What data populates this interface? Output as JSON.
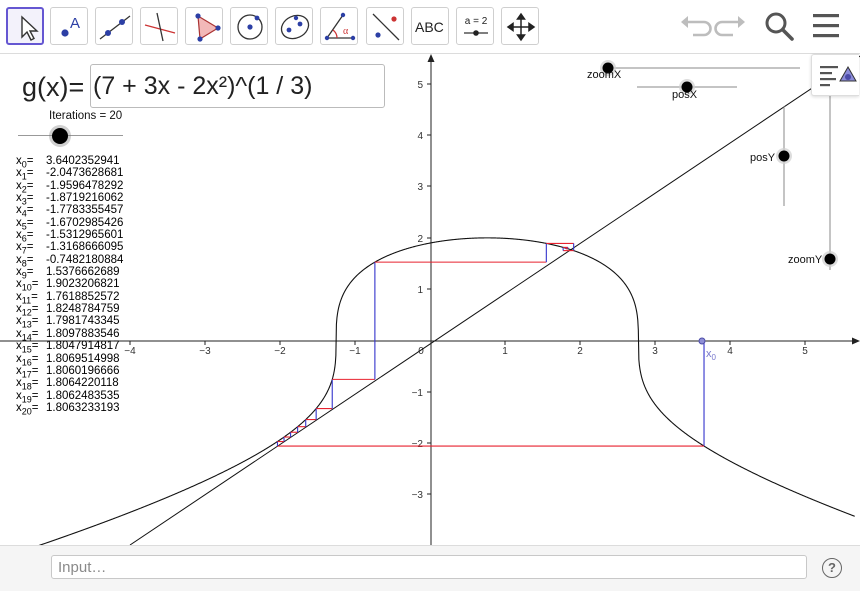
{
  "toolbar": {
    "tools": [
      {
        "name": "move-tool",
        "icon": "arrow-cursor-icon",
        "selected": true
      },
      {
        "name": "point-tool",
        "icon": "point-icon",
        "label": "A"
      },
      {
        "name": "line-tool",
        "icon": "line-through-points-icon"
      },
      {
        "name": "perpendicular-line-tool",
        "icon": "perpendicular-line-icon"
      },
      {
        "name": "polygon-tool",
        "icon": "polygon-icon"
      },
      {
        "name": "circle-center-tool",
        "icon": "circle-with-center-icon"
      },
      {
        "name": "ellipse-tool",
        "icon": "ellipse-icon"
      },
      {
        "name": "angle-tool",
        "icon": "angle-icon",
        "label": "α"
      },
      {
        "name": "reflect-tool",
        "icon": "reflect-about-line-icon"
      },
      {
        "name": "text-tool",
        "icon": "text-icon",
        "label": "ABC"
      },
      {
        "name": "slider-tool",
        "icon": "slider-icon",
        "label": "a = 2"
      },
      {
        "name": "move-graphics-view-tool",
        "icon": "move-view-icon"
      }
    ],
    "undo_icon": "undo-icon",
    "redo_icon": "redo-icon",
    "search_icon": "search-icon",
    "menu_icon": "hamburger-menu-icon"
  },
  "formula": {
    "label": "g(x)=",
    "value": "(7 + 3x - 2x²)^(1 / 3)"
  },
  "iterations": {
    "label": "Iterations = 20",
    "value": 20
  },
  "iterates": [
    {
      "sub": "0",
      "value": "3.6402352941"
    },
    {
      "sub": "1",
      "value": "-2.0473628681"
    },
    {
      "sub": "2",
      "value": "-1.9596478292"
    },
    {
      "sub": "3",
      "value": "-1.8719216062"
    },
    {
      "sub": "4",
      "value": "-1.7783355457"
    },
    {
      "sub": "5",
      "value": "-1.6702985426"
    },
    {
      "sub": "6",
      "value": "-1.5312965601"
    },
    {
      "sub": "7",
      "value": "-1.3168666095"
    },
    {
      "sub": "8",
      "value": "-0.7482180884"
    },
    {
      "sub": "9",
      "value": "1.5376662689"
    },
    {
      "sub": "10",
      "value": "1.9023206821"
    },
    {
      "sub": "11",
      "value": "1.7618852572"
    },
    {
      "sub": "12",
      "value": "1.8248784759"
    },
    {
      "sub": "13",
      "value": "1.7981743345"
    },
    {
      "sub": "14",
      "value": "1.8097883546"
    },
    {
      "sub": "15",
      "value": "1.8047914817"
    },
    {
      "sub": "16",
      "value": "1.8069514998"
    },
    {
      "sub": "17",
      "value": "1.8060196666"
    },
    {
      "sub": "18",
      "value": "1.8064220118"
    },
    {
      "sub": "19",
      "value": "1.8062483535"
    },
    {
      "sub": "20",
      "value": "1.8063233193"
    }
  ],
  "graph": {
    "x_ticks": [
      "−4",
      "−3",
      "−2",
      "−1",
      "0",
      "1",
      "2",
      "3",
      "4",
      "5"
    ],
    "y_ticks": [
      "5",
      "4",
      "3",
      "2",
      "1",
      "−1",
      "−2",
      "−3"
    ],
    "x0_label": "x",
    "x0_sub": "0",
    "sliders": {
      "zoomX": "zoomX",
      "posX": "posX",
      "posY": "posY",
      "zoomY": "zoomY"
    },
    "colors": {
      "curve": "#000000",
      "vertical_steps": "#3333cc",
      "horizontal_steps": "#e8222f",
      "x0_point": "#7777cc"
    }
  },
  "stylebar_icon": "graphics-stylebar-icon",
  "input_bar": {
    "placeholder": "Input…",
    "help_icon": "?"
  }
}
